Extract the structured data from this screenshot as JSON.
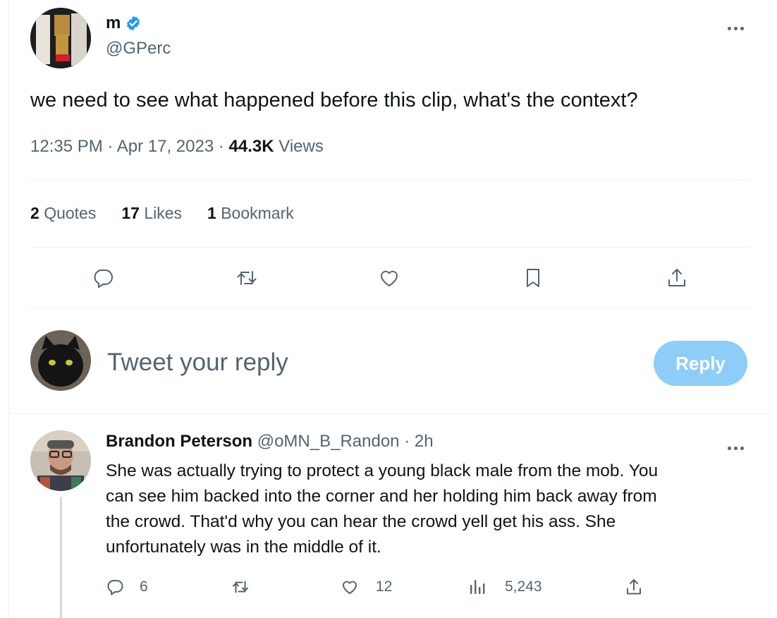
{
  "tweet": {
    "display_name": "m",
    "handle": "@GPerc",
    "text": "we need to see what happened before this clip, what's the context?",
    "time": "12:35 PM",
    "date": "Apr 17, 2023",
    "views_count": "44.3K",
    "views_label": "Views",
    "sep": "·",
    "stats": {
      "quotes_count": "2",
      "quotes_label": "Quotes",
      "likes_count": "17",
      "likes_label": "Likes",
      "bookmarks_count": "1",
      "bookmarks_label": "Bookmark"
    }
  },
  "reply_box": {
    "placeholder": "Tweet your reply",
    "button_label": "Reply"
  },
  "reply": {
    "display_name": "Brandon Peterson",
    "handle": "@oMN_B_Randon",
    "time": "2h",
    "sep": "·",
    "text_lines": [
      "She was actually trying to protect a young black male from the mob. You",
      "can see him backed into the corner and her holding him back away from",
      "the crowd. That'd why you can hear the crowd yell get his ass. She",
      "unfortunately was in the middle of it."
    ],
    "reply_count": "6",
    "like_count": "12",
    "view_count": "5,243"
  },
  "icons": {
    "verified": "verified-badge-icon",
    "more": "more-icon",
    "reply": "reply-icon",
    "retweet": "retweet-icon",
    "like": "like-icon",
    "bookmark": "bookmark-icon",
    "share": "share-icon",
    "views": "views-icon"
  },
  "colors": {
    "brand": "#1d9bf0",
    "reply_button_disabled": "#8ecdf8",
    "muted": "#536471",
    "text": "#0f1419",
    "divider": "#eff3f4"
  }
}
